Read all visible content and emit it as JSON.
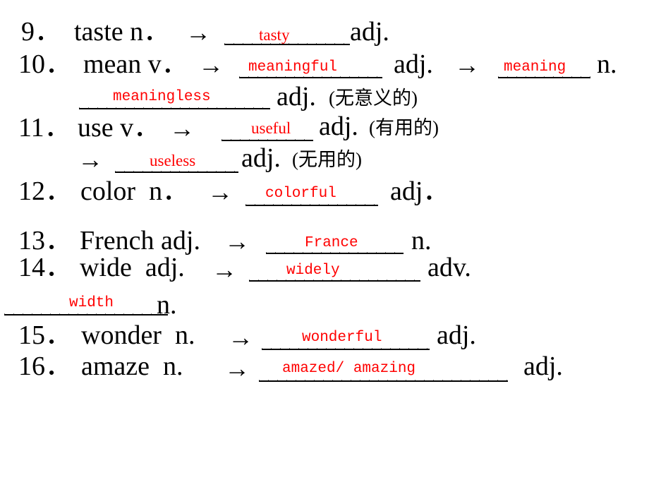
{
  "document": {
    "type": "worksheet",
    "topic": "English word-form derivation exercise",
    "answer_color": "#ff0000",
    "text_color": "#000000",
    "background_color": "#ffffff"
  },
  "symbols": {
    "arrow": "→",
    "open_paren": "(",
    "close_paren": ")"
  },
  "items": [
    {
      "number": "9．",
      "prompt": "taste n．",
      "arrow": "→",
      "answer": "tasty",
      "pos": "adj."
    },
    {
      "number": "10．",
      "prompt": "mean v．",
      "arrow": "→",
      "answer": "meaningful",
      "pos": "adj.",
      "arrow2": "→",
      "answer2": "meaning",
      "pos2": "n.",
      "answer3": "meaningless",
      "pos3": "adj.",
      "gloss3": "(无意义的)"
    },
    {
      "number": "11．",
      "prompt": "use v．",
      "arrow": "→",
      "answer": "useful",
      "pos": "adj.",
      "gloss": "(有用的)",
      "arrow2": "→",
      "answer2": "useless",
      "pos2": "adj.",
      "gloss2": "(无用的)"
    },
    {
      "number": "12．",
      "prompt": "color  n．",
      "arrow": "→",
      "answer": "colorful",
      "pos": "adj．"
    },
    {
      "number": "13．",
      "prompt": "French adj.",
      "arrow": "→",
      "answer": "France",
      "pos": "n."
    },
    {
      "number": "14．",
      "prompt": "wide  adj.",
      "arrow": "→",
      "answer": "widely",
      "pos": "adv.",
      "answer2": "width",
      "pos2": "n."
    },
    {
      "number": "15．",
      "prompt": "wonder  n.",
      "arrow": "→",
      "answer": "wonderful",
      "pos": "adj."
    },
    {
      "number": "16．",
      "prompt": "amaze  n.",
      "arrow": "→",
      "answer": "amazed/ amazing",
      "pos": "adj."
    }
  ]
}
